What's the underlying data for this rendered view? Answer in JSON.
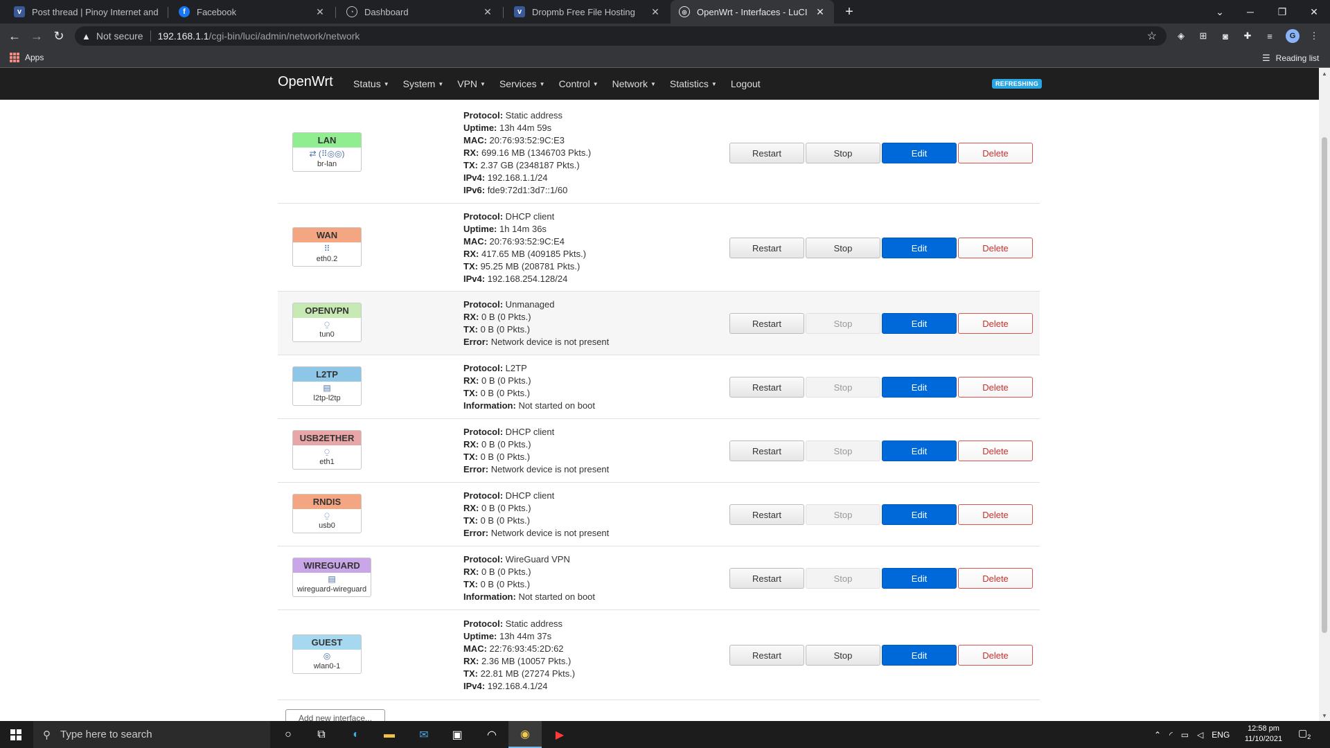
{
  "browser": {
    "tabs": [
      {
        "title": "Post thread | Pinoy Internet and",
        "icon": "vbulletin-icon",
        "active": false
      },
      {
        "title": "Facebook",
        "icon": "facebook-icon",
        "active": false
      },
      {
        "title": "Dashboard",
        "icon": "dashboard-icon",
        "active": false
      },
      {
        "title": "Dropmb Free File Hosting",
        "icon": "vbulletin-icon",
        "active": false
      },
      {
        "title": "OpenWrt - Interfaces - LuCI",
        "icon": "openwrt-icon",
        "active": true
      }
    ],
    "address": {
      "security_label": "Not secure",
      "host": "192.168.1.1",
      "path": "/cgi-bin/luci/admin/network/network"
    },
    "bookmarks": {
      "apps_label": "Apps",
      "reading_list_label": "Reading list"
    },
    "profile_initial": "G"
  },
  "luci": {
    "brand": "OpenWrt",
    "menu": [
      "Status",
      "System",
      "VPN",
      "Services",
      "Control",
      "Network",
      "Statistics",
      "Logout"
    ],
    "refresh_badge": "REFRESHING",
    "add_interface_label": "Add new interface...",
    "buttons": {
      "restart": "Restart",
      "stop": "Stop",
      "edit": "Edit",
      "delete": "Delete"
    },
    "interfaces": [
      {
        "name": "LAN",
        "device": "br-lan",
        "header_color": "#90ee90",
        "icons": "⇄ (⠿◎◎)",
        "stop_enabled": true,
        "shaded": false,
        "info": [
          {
            "k": "Protocol:",
            "v": " Static address"
          },
          {
            "k": "Uptime:",
            "v": " 13h 44m 59s"
          },
          {
            "k": "MAC:",
            "v": " 20:76:93:52:9C:E3"
          },
          {
            "k": "RX:",
            "v": " 699.16 MB (1346703 Pkts.)"
          },
          {
            "k": "TX:",
            "v": " 2.37 GB (2348187 Pkts.)"
          },
          {
            "k": "IPv4:",
            "v": " 192.168.1.1/24"
          },
          {
            "k": "IPv6:",
            "v": " fde9:72d1:3d7::1/60"
          }
        ]
      },
      {
        "name": "WAN",
        "device": "eth0.2",
        "header_color": "#f4a582",
        "icons": "⠿",
        "stop_enabled": true,
        "shaded": false,
        "info": [
          {
            "k": "Protocol:",
            "v": " DHCP client"
          },
          {
            "k": "Uptime:",
            "v": " 1h 14m 36s"
          },
          {
            "k": "MAC:",
            "v": " 20:76:93:52:9C:E4"
          },
          {
            "k": "RX:",
            "v": " 417.65 MB (409185 Pkts.)"
          },
          {
            "k": "TX:",
            "v": " 95.25 MB (208781 Pkts.)"
          },
          {
            "k": "IPv4:",
            "v": " 192.168.254.128/24"
          }
        ]
      },
      {
        "name": "OPENVPN",
        "device": "tun0",
        "header_color": "#c7e9b4",
        "icons": "⍜",
        "stop_enabled": false,
        "shaded": true,
        "info": [
          {
            "k": "Protocol:",
            "v": " Unmanaged"
          },
          {
            "k": "RX:",
            "v": " 0 B (0 Pkts.)"
          },
          {
            "k": "TX:",
            "v": " 0 B (0 Pkts.)"
          },
          {
            "k": "Error:",
            "v": " Network device is not present"
          }
        ]
      },
      {
        "name": "L2TP",
        "device": "l2tp-l2tp",
        "header_color": "#8ec6e8",
        "icons": "▤",
        "stop_enabled": false,
        "shaded": false,
        "info": [
          {
            "k": "Protocol:",
            "v": " L2TP"
          },
          {
            "k": "RX:",
            "v": " 0 B (0 Pkts.)"
          },
          {
            "k": "TX:",
            "v": " 0 B (0 Pkts.)"
          },
          {
            "k": "Information:",
            "v": " Not started on boot"
          }
        ]
      },
      {
        "name": "USB2ETHER",
        "device": "eth1",
        "header_color": "#e8a6a6",
        "icons": "⍜",
        "stop_enabled": false,
        "shaded": false,
        "info": [
          {
            "k": "Protocol:",
            "v": " DHCP client"
          },
          {
            "k": "RX:",
            "v": " 0 B (0 Pkts.)"
          },
          {
            "k": "TX:",
            "v": " 0 B (0 Pkts.)"
          },
          {
            "k": "Error:",
            "v": " Network device is not present"
          }
        ]
      },
      {
        "name": "RNDIS",
        "device": "usb0",
        "header_color": "#f4a582",
        "icons": "⍜",
        "stop_enabled": false,
        "shaded": false,
        "info": [
          {
            "k": "Protocol:",
            "v": " DHCP client"
          },
          {
            "k": "RX:",
            "v": " 0 B (0 Pkts.)"
          },
          {
            "k": "TX:",
            "v": " 0 B (0 Pkts.)"
          },
          {
            "k": "Error:",
            "v": " Network device is not present"
          }
        ]
      },
      {
        "name": "WIREGUARD",
        "device": "wireguard-wireguard",
        "header_color": "#c9a6e8",
        "icons": "▤",
        "stop_enabled": false,
        "shaded": false,
        "info": [
          {
            "k": "Protocol:",
            "v": " WireGuard VPN"
          },
          {
            "k": "RX:",
            "v": " 0 B (0 Pkts.)"
          },
          {
            "k": "TX:",
            "v": " 0 B (0 Pkts.)"
          },
          {
            "k": "Information:",
            "v": " Not started on boot"
          }
        ]
      },
      {
        "name": "GUEST",
        "device": "wlan0-1",
        "header_color": "#a6d8f0",
        "icons": "◎",
        "stop_enabled": true,
        "shaded": false,
        "info": [
          {
            "k": "Protocol:",
            "v": " Static address"
          },
          {
            "k": "Uptime:",
            "v": " 13h 44m 37s"
          },
          {
            "k": "MAC:",
            "v": " 22:76:93:45:2D:62"
          },
          {
            "k": "RX:",
            "v": " 2.36 MB (10057 Pkts.)"
          },
          {
            "k": "TX:",
            "v": " 22.81 MB (27274 Pkts.)"
          },
          {
            "k": "IPv4:",
            "v": " 192.168.4.1/24"
          }
        ]
      }
    ]
  },
  "taskbar": {
    "search_placeholder": "Type here to search",
    "language": "ENG",
    "time": "12:58 pm",
    "date": "11/10/2021",
    "notification_count": "2"
  }
}
